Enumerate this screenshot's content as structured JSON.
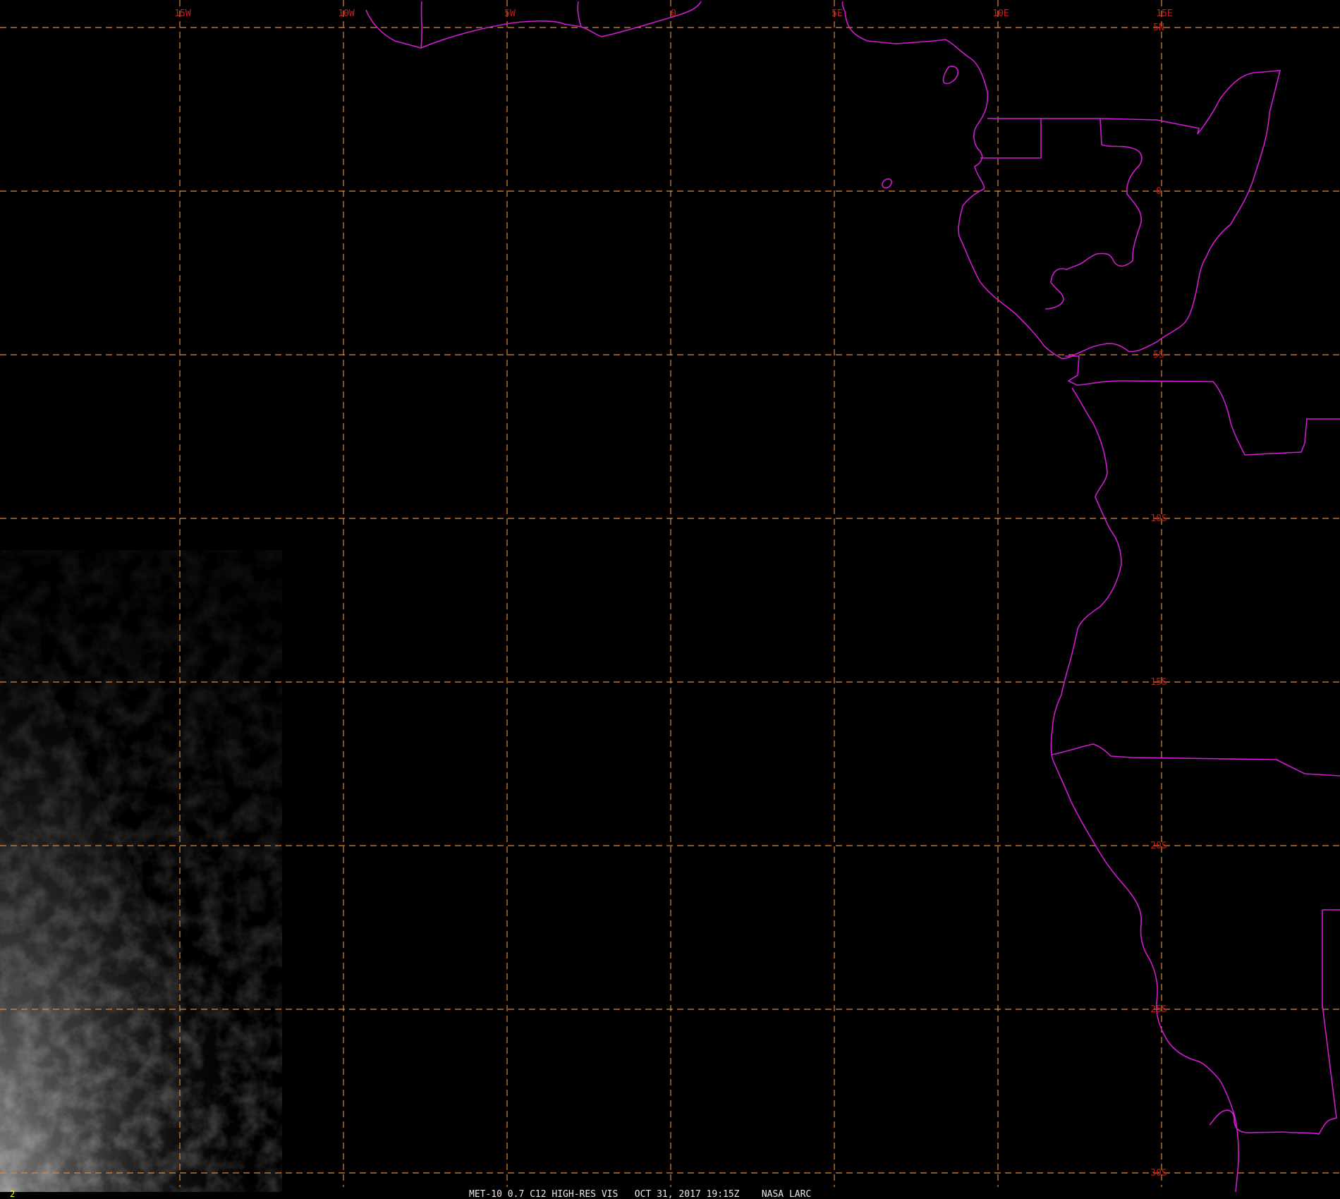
{
  "map": {
    "caption": "MET-10 0.7 C12 HIGH-RES VIS   OCT 31, 2017 19:15Z    NASA LARC",
    "frame_number": "2",
    "longitude_labels": [
      "15W",
      "10W",
      "5W",
      "0",
      "5E",
      "10E",
      "15E"
    ],
    "latitude_labels": [
      "5N",
      "0",
      "5S",
      "10S",
      "15S",
      "20S",
      "25S",
      "30S"
    ],
    "colors": {
      "background": "#000000",
      "gridlines": "#d98c3a",
      "grid_labels": "#d01818",
      "borders": "#d21ad2",
      "caption": "#e6e6e6",
      "frame_number": "#ffff00"
    }
  }
}
